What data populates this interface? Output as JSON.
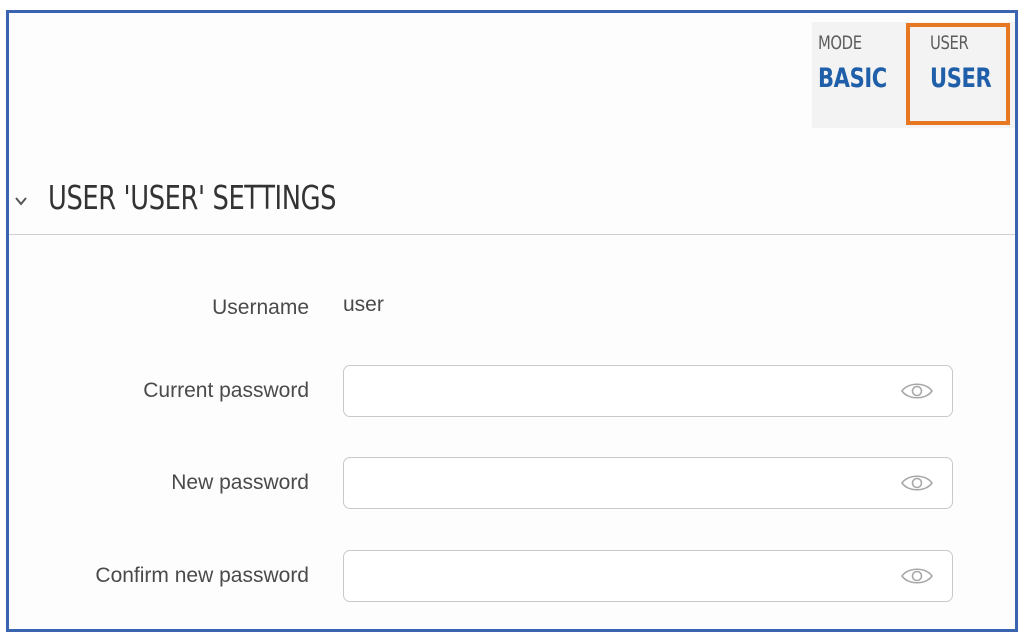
{
  "header": {
    "mode_label": "MODE",
    "mode_value": "BASIC",
    "user_label": "USER",
    "user_value": "USER"
  },
  "section": {
    "title": "USER 'USER' SETTINGS",
    "toggle_icon": "chevron-down-icon"
  },
  "fields": {
    "username": {
      "label": "Username",
      "value": "user"
    },
    "current_password": {
      "label": "Current password",
      "value": "",
      "icon": "eye-icon"
    },
    "new_password": {
      "label": "New password",
      "value": "",
      "icon": "eye-icon"
    },
    "confirm_password": {
      "label": "Confirm new password",
      "value": "",
      "icon": "eye-icon"
    }
  },
  "colors": {
    "frame_border": "#3b64b0",
    "accent_blue": "#1f5ea8",
    "highlight_orange": "#e87722"
  }
}
